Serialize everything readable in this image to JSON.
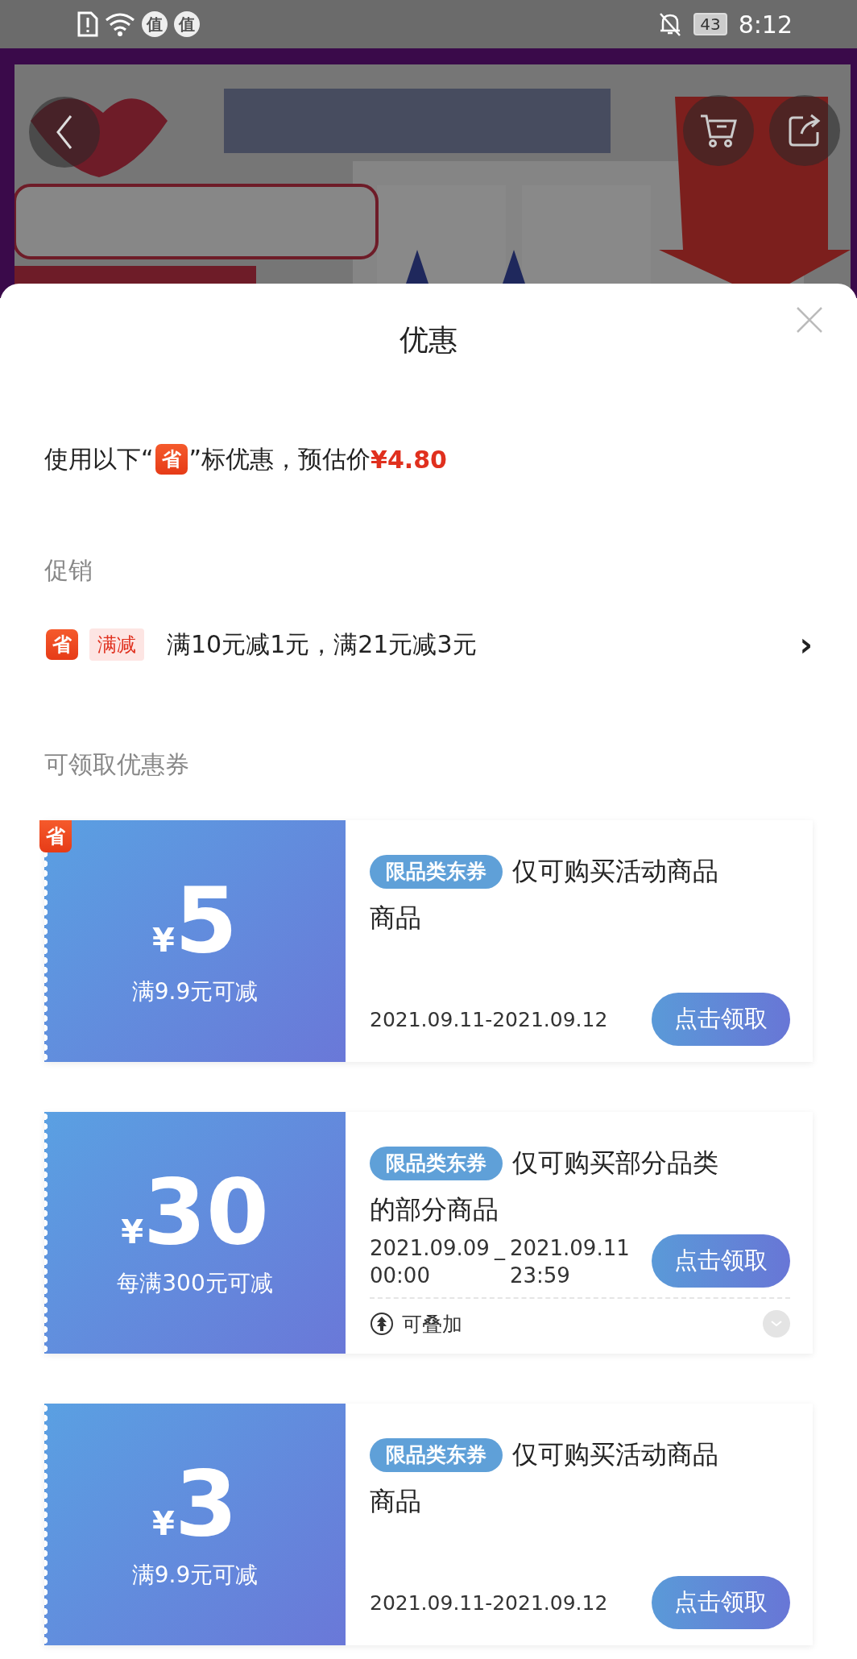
{
  "status_bar": {
    "notifications": [
      "值",
      "值"
    ],
    "battery": "43",
    "time": "8:12"
  },
  "sheet": {
    "title": "优惠",
    "estimate": {
      "before": "使用以下“",
      "badge": "省",
      "after": "”标优惠，预估价",
      "price": "¥4.80"
    },
    "promotion": {
      "heading": "促销",
      "badge": "省",
      "tag": "满减",
      "text": "满10元减1元，满21元减3元",
      "chevron": "›"
    },
    "coupons_heading": "可领取优惠券",
    "coupons": [
      {
        "kind": "simple",
        "badge": "省",
        "currency": "¥",
        "amount": "5",
        "condition": "满9.9元可减",
        "tag": "限品类东券",
        "description": "仅可购买活动商品商品",
        "validity": "2021.09.11-2021.09.12",
        "button": "点击领取"
      },
      {
        "kind": "timed",
        "currency": "¥",
        "amount": "30",
        "condition": "每满300元可减",
        "tag": "限品类东券",
        "description": "仅可购买部分品类的部分商品",
        "start_date": "2021.09.09",
        "start_time": "00:00",
        "separator": "_",
        "end_date": "2021.09.11",
        "end_time": "23:59",
        "button": "点击领取",
        "note": "可叠加"
      },
      {
        "kind": "simple",
        "currency": "¥",
        "amount": "3",
        "condition": "满9.9元可减",
        "tag": "限品类东券",
        "description": "仅可购买活动商品商品",
        "validity": "2021.09.11-2021.09.12",
        "button": "点击领取"
      }
    ]
  }
}
